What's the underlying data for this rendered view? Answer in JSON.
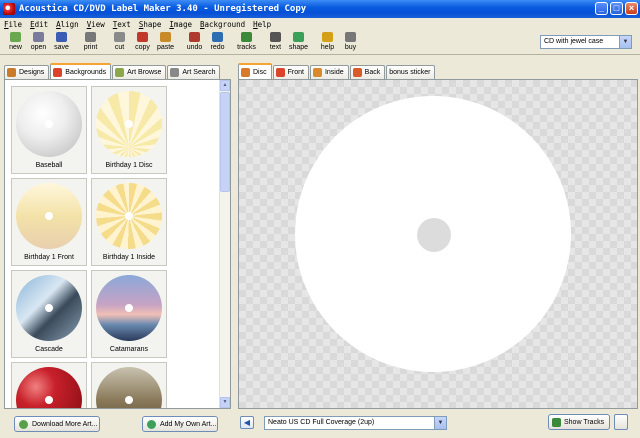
{
  "window": {
    "title": "Acoustica CD/DVD Label Maker 3.40 - Unregistered Copy",
    "controls": [
      "_",
      "□",
      "×"
    ]
  },
  "menu": [
    "File",
    "Edit",
    "Align",
    "View",
    "Text",
    "Shape",
    "Image",
    "Background",
    "Help"
  ],
  "toolbar": {
    "tools": [
      {
        "label": "new",
        "icon": "new-icon",
        "color": "#6aa84f"
      },
      {
        "label": "open",
        "icon": "open-icon",
        "color": "#7a7a9a"
      },
      {
        "label": "save",
        "icon": "save-icon",
        "color": "#3b5bb5"
      },
      {
        "label": "print",
        "icon": "print-icon",
        "color": "#777777"
      },
      {
        "label": "cut",
        "icon": "cut-icon",
        "color": "#8a8a8a"
      },
      {
        "label": "copy",
        "icon": "copy-icon",
        "color": "#c0392b"
      },
      {
        "label": "paste",
        "icon": "paste-icon",
        "color": "#c98a2a"
      },
      {
        "label": "undo",
        "icon": "undo-icon",
        "color": "#b03a2e"
      },
      {
        "label": "redo",
        "icon": "redo-icon",
        "color": "#2e6db0"
      },
      {
        "label": "tracks",
        "icon": "tracks-icon",
        "color": "#3a8a3a"
      },
      {
        "label": "text",
        "icon": "text-icon",
        "color": "#555555"
      },
      {
        "label": "shape",
        "icon": "shape-icon",
        "color": "#3aa05a"
      },
      {
        "label": "help",
        "icon": "help-icon",
        "color": "#d4a017"
      },
      {
        "label": "buy",
        "icon": "buy-icon",
        "color": "#777777"
      }
    ],
    "case_select": "CD with jewel case"
  },
  "left_tabs": [
    {
      "label": "Designs",
      "icon": "designs-icon",
      "color": "#c97a2a",
      "active": false
    },
    {
      "label": "Backgrounds",
      "icon": "backgrounds-icon",
      "color": "#d9442b",
      "active": true
    },
    {
      "label": "Art Browse",
      "icon": "art-browse-icon",
      "color": "#8aa84a",
      "active": false
    },
    {
      "label": "Art Search",
      "icon": "art-search-icon",
      "color": "#888888",
      "active": false
    }
  ],
  "backgrounds": [
    {
      "label": "Baseball"
    },
    {
      "label": "Birthday 1 Disc"
    },
    {
      "label": "Birthday 1 Front"
    },
    {
      "label": "Birthday 1 Inside"
    },
    {
      "label": "Cascade"
    },
    {
      "label": "Catamarans"
    },
    {
      "label": ""
    },
    {
      "label": ""
    }
  ],
  "left_buttons": {
    "download": "Download More Art...",
    "add_own": "Add My Own Art..."
  },
  "right_tabs": [
    {
      "label": "Disc",
      "icon": "disc-tab-icon",
      "color": "#d97a2a",
      "active": true
    },
    {
      "label": "Front",
      "icon": "front-tab-icon",
      "color": "#d9442b",
      "active": false
    },
    {
      "label": "Inside",
      "icon": "inside-tab-icon",
      "color": "#d98a2a",
      "active": false
    },
    {
      "label": "Back",
      "icon": "back-tab-icon",
      "color": "#d95a2a",
      "active": false
    },
    {
      "label": "bonus sticker",
      "icon": "",
      "color": "",
      "active": false
    }
  ],
  "bottom_right": {
    "sheet_select": "Neato US CD Full Coverage (2up)",
    "show_tracks": "Show Tracks"
  }
}
